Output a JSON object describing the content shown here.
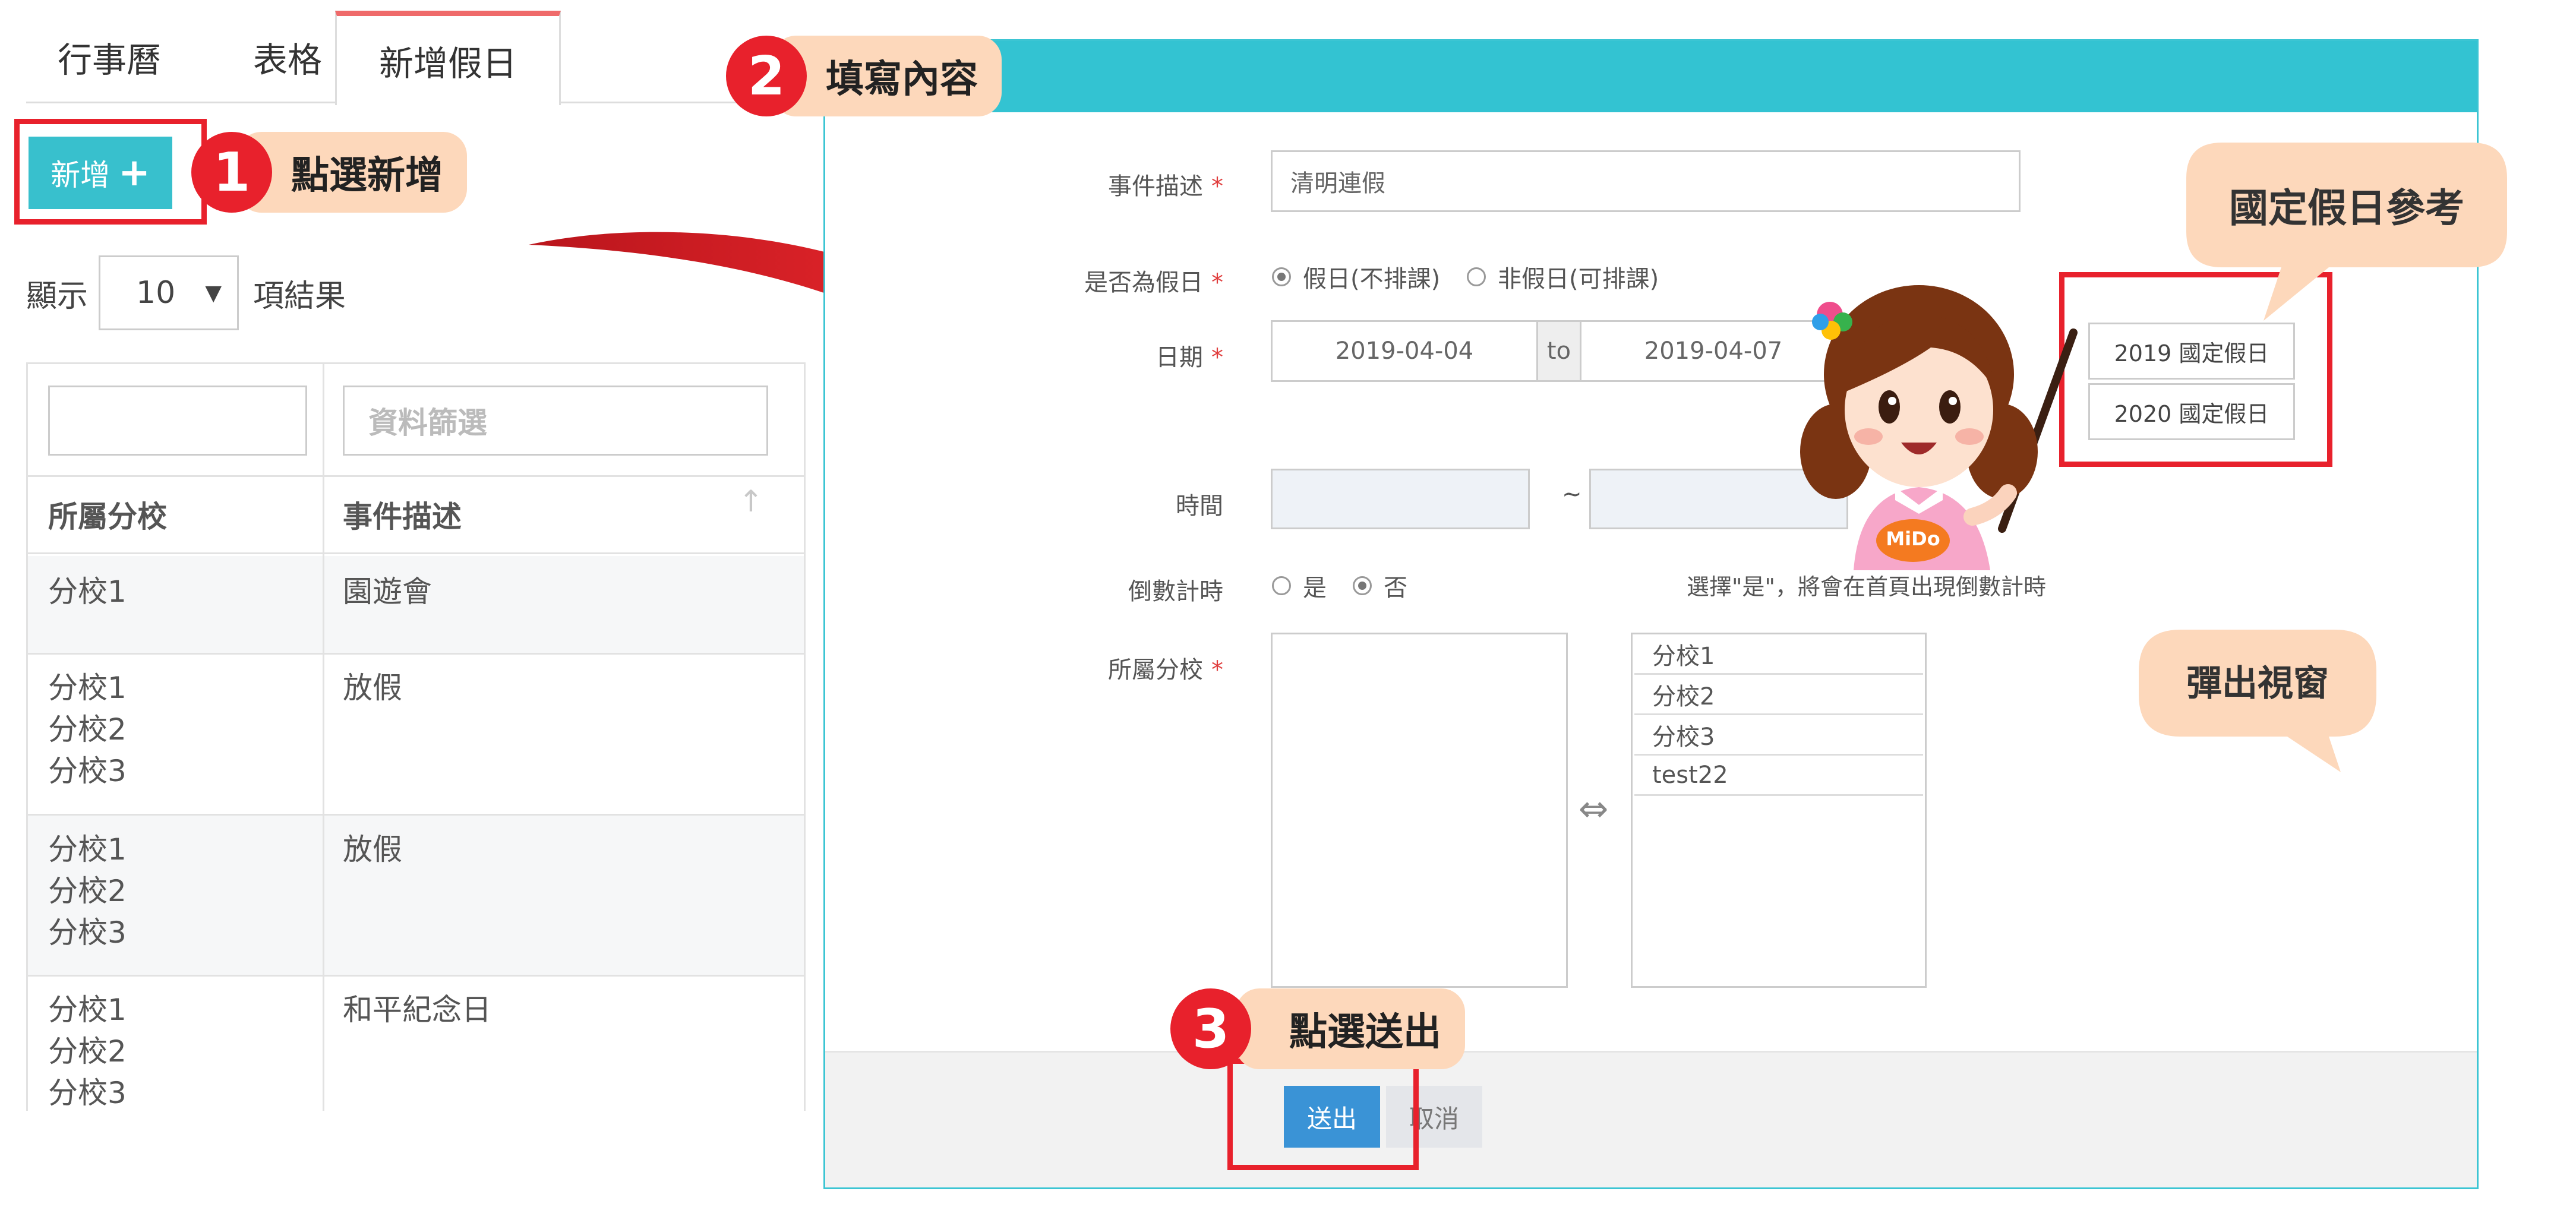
{
  "tabs": [
    {
      "label": "行事曆"
    },
    {
      "label": "表格"
    },
    {
      "label": "新增假日"
    }
  ],
  "add_button": {
    "label": "新增",
    "icon": "plus-icon"
  },
  "show_entries": {
    "prefix": "顯示",
    "value": "10",
    "suffix": "項結果"
  },
  "list_table": {
    "filter_placeholder": "資料篩選",
    "columns": [
      "所屬分校",
      "事件描述"
    ],
    "sort_icon": "arrow-up-icon",
    "rows": [
      {
        "branch": "分校1",
        "event": "園遊會"
      },
      {
        "branch": "分校1\n分校2\n分校3",
        "event": "放假"
      },
      {
        "branch": "分校1\n分校2\n分校3",
        "event": "放假"
      },
      {
        "branch": "分校1\n分校2\n分校3",
        "event": "和平紀念日"
      }
    ]
  },
  "form": {
    "event_label": "事件描述",
    "event_value": "清明連假",
    "holiday_label": "是否為假日",
    "holiday_option_yes": "假日(不排課)",
    "holiday_option_no": "非假日(可排課)",
    "date_label": "日期",
    "date_start": "2019-04-04",
    "date_sep": "to",
    "date_end": "2019-04-07",
    "time_label": "時間",
    "time_sep": "~",
    "countdown_label": "倒數計時",
    "countdown_yes": "是",
    "countdown_no": "否",
    "countdown_hint": "選擇\"是\"，將會在首頁出現倒數計時",
    "branch_label": "所屬分校",
    "required_mark": "*",
    "transfer_icon": "⇔",
    "branch_options": [
      "分校1",
      "分校2",
      "分校3",
      "test22"
    ],
    "holiday_ref_buttons": [
      "2019 國定假日",
      "2020 國定假日"
    ],
    "submit_label": "送出",
    "cancel_label": "取消"
  },
  "annotations": {
    "step1_number": "1",
    "step1_text": "點選新增",
    "step2_number": "2",
    "step2_text": "填寫內容",
    "step3_number": "3",
    "step3_text": "點選送出",
    "holiday_ref_note": "國定假日參考",
    "popup_note": "彈出視窗",
    "mascot_badge": "MiDo"
  },
  "colors": {
    "accent": "#33c3d2",
    "annotation_red": "#e8212c",
    "callout_bg": "#fdd8bb",
    "submit_blue": "#3a93d6"
  }
}
